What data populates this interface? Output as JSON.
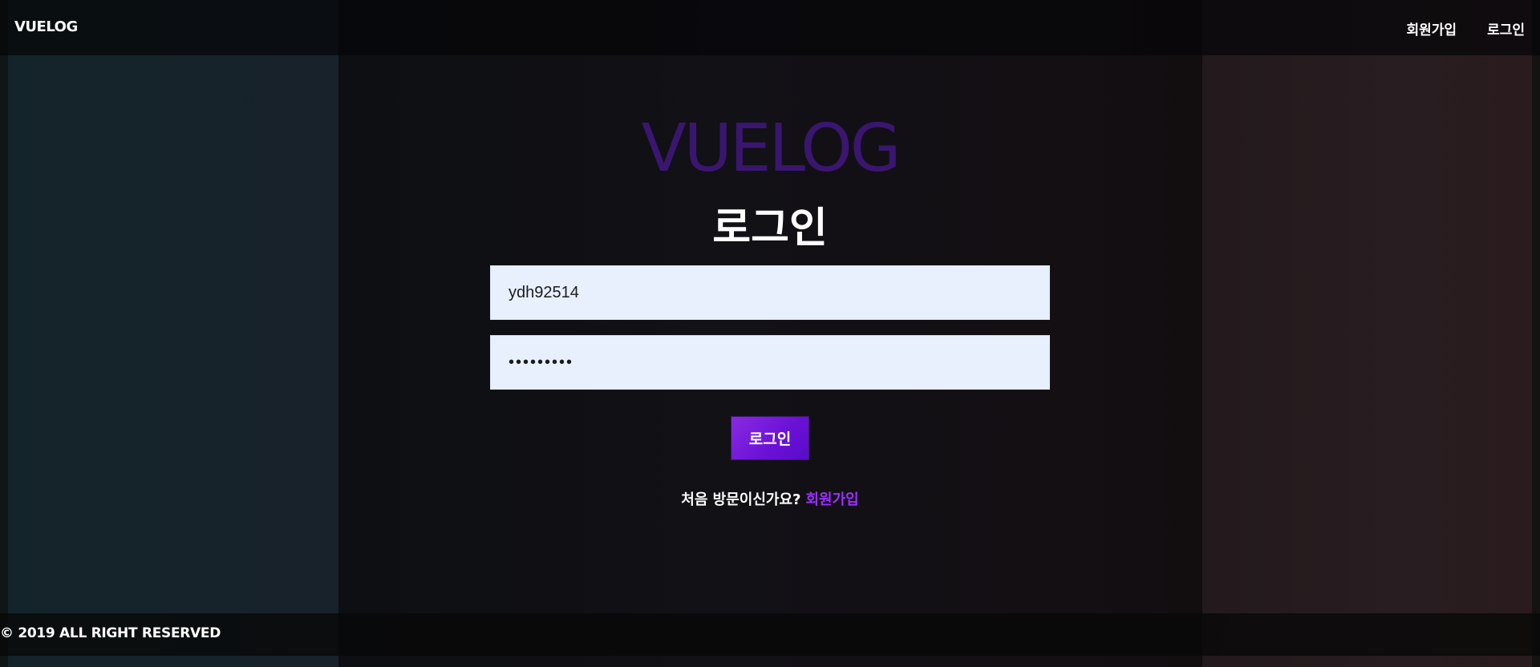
{
  "header": {
    "brand": "VUELOG",
    "nav": {
      "signup": "회원가입",
      "login": "로그인"
    }
  },
  "login": {
    "logo": "VUELOG",
    "title": "로그인",
    "username_value": "ydh92514",
    "password_value": "•••••••••",
    "submit_label": "로그인",
    "signup_prompt": "처음 방문이신가요?",
    "signup_link": "회원가입"
  },
  "footer": {
    "copyright": "© 2019 ALL RIGHT RESERVED"
  },
  "colors": {
    "accent": "#8a2be2",
    "logo": "#3a1670",
    "link": "#9b30ff",
    "input_bg": "#e8f0fe"
  }
}
